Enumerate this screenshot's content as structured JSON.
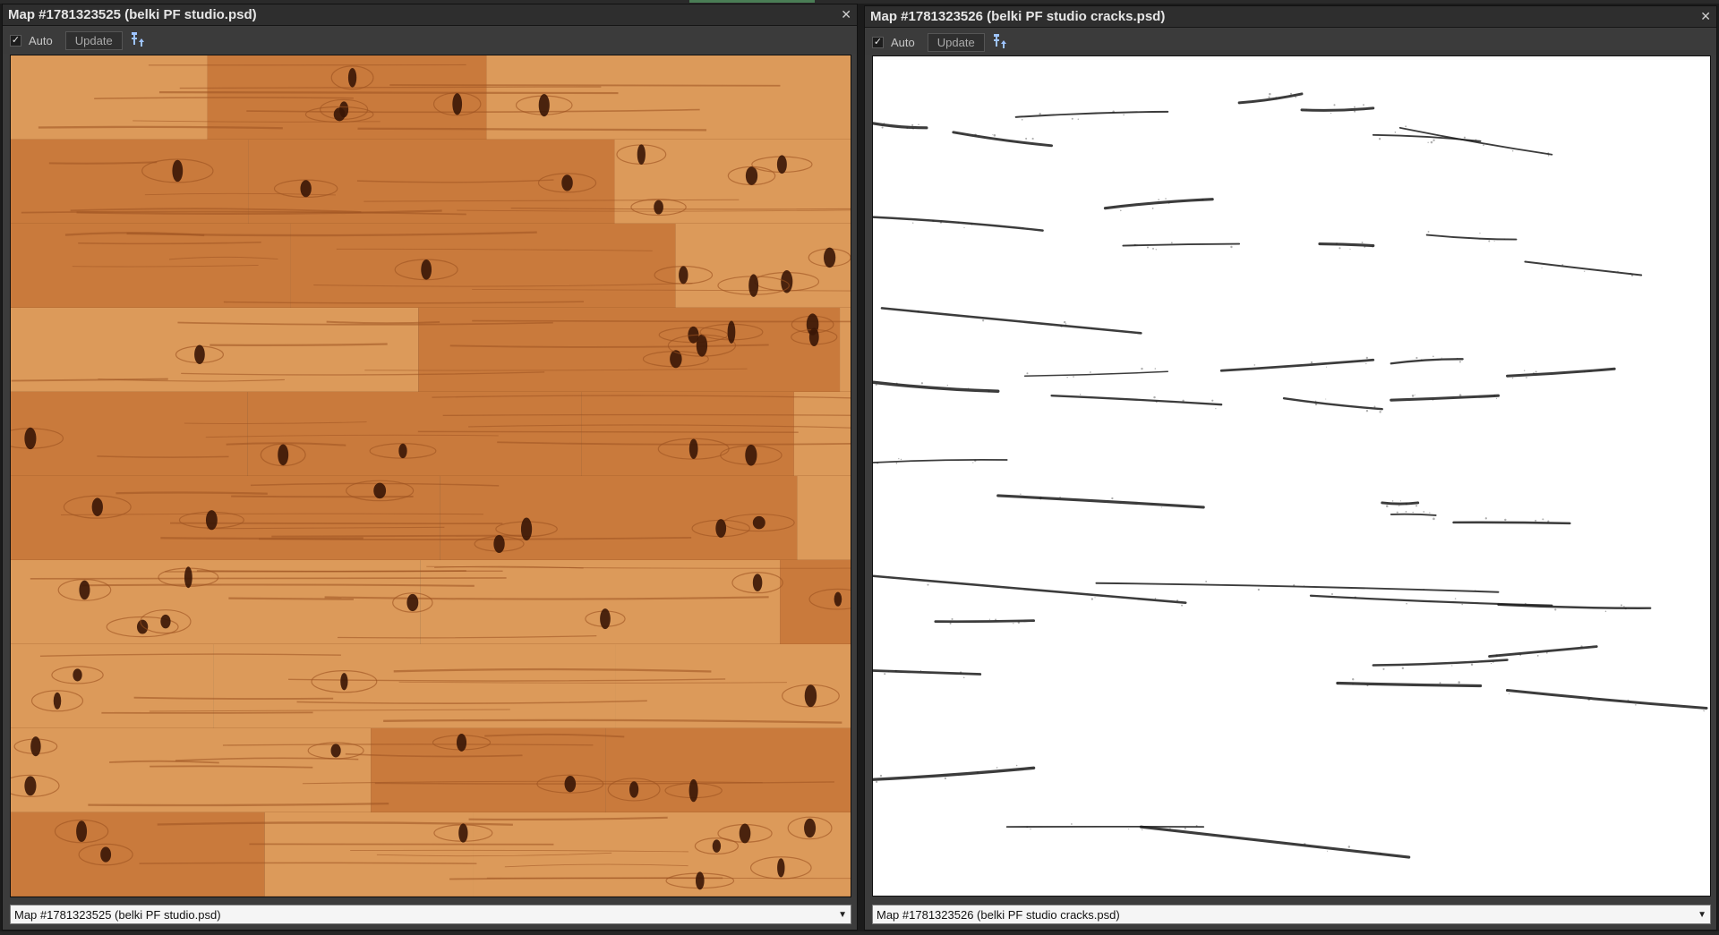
{
  "left_window": {
    "title": "Map #1781323525 (belki PF studio.psd)",
    "auto_label": "Auto",
    "auto_checked": true,
    "update_label": "Update",
    "map_select_value": "Map #1781323525 (belki PF studio.psd)",
    "preview_icon": "pine-wood-texture"
  },
  "right_window": {
    "title": "Map #1781323526 (belki PF studio cracks.psd)",
    "auto_label": "Auto",
    "auto_checked": true,
    "update_label": "Update",
    "map_select_value": "Map #1781323526 (belki PF studio cracks.psd)",
    "preview_icon": "cracks-mask-texture"
  },
  "colors": {
    "wood_base": "#c97a3c",
    "wood_light": "#dc9a5a",
    "wood_grain": "#9c5220",
    "knot": "#3a1606",
    "crack": "#1a1a1a"
  },
  "icons": {
    "close": "close-icon",
    "checkbox": "checkmark-icon",
    "pin": "pin-to-top-icon",
    "dropdown": "chevron-down-icon"
  }
}
